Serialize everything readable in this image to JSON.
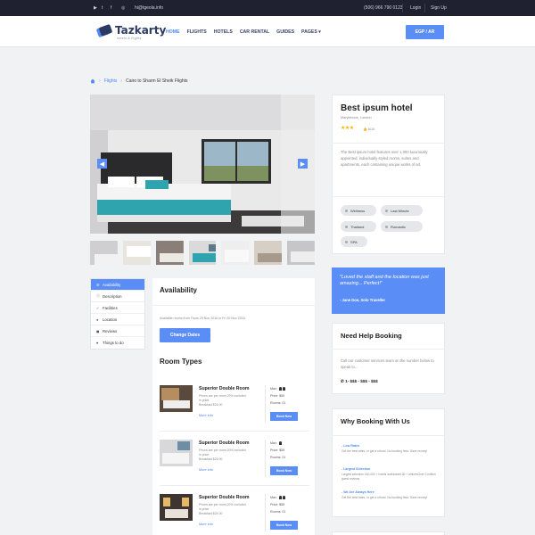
{
  "topbar": {
    "social": [
      "▶",
      "t",
      "f",
      "◎"
    ],
    "email": "hi@tgeola.info",
    "phone": "(506) 966 790 0123",
    "login": "Login",
    "signup": "Sign Up"
  },
  "header": {
    "logo": "Tazkarty",
    "tagline": "hotels & flights",
    "nav": [
      "HOME",
      "FLIGHTS",
      "HOTELS",
      "CAR RENTAL",
      "GUIDES",
      "PAGES ▾"
    ],
    "cta": "EGP / AR"
  },
  "breadcrumb": {
    "items": [
      "Flights",
      "Cairo to Sharm El Sheik Flights"
    ]
  },
  "tabs": [
    "Availability",
    "Description",
    "Facilities",
    "Location",
    "Reviews",
    "Things to do"
  ],
  "availability": {
    "title": "Availability",
    "text": "Available rooms from Thurs 29 Nov 2016 to Fri 30 Nov 2016.",
    "button": "Change Dates"
  },
  "rooms": {
    "title": "Room Types",
    "items": [
      {
        "name": "Superior Double Room",
        "desc1": "Prices are per room 20% included",
        "desc2": "in price",
        "desc3": "Breakfast $24.00",
        "more": "More info",
        "max": "Max:",
        "price": "Price: $50",
        "rooms": "Rooms: 01",
        "book": "Book Now"
      },
      {
        "name": "Superior Double Room",
        "desc1": "Prices are per room 20% included",
        "desc2": "in price",
        "desc3": "Breakfast $24.00",
        "more": "More info",
        "max": "Max:",
        "price": "Price: $55",
        "rooms": "Rooms: 01",
        "book": "Book Now"
      },
      {
        "name": "Superior Double Room",
        "desc1": "Prices are per room 20% included",
        "desc2": "in price",
        "desc3": "Breakfast $24.00",
        "more": "More info",
        "max": "Max:",
        "price": "Price: $55",
        "rooms": "Rooms: 01",
        "book": "Book Now"
      }
    ]
  },
  "hotel": {
    "name": "Best ipsum hotel",
    "location": "Marylebone, London",
    "stars": "★★★",
    "rating": "8/10",
    "description": "The Best ipsum hotel features over 1,000 luxuriously appointed, individually styled rooms, suites and apartments, each containing unique works of art.",
    "tags": [
      "Wellness",
      "Last Minute",
      "Thailand",
      "Romantic",
      "SPA"
    ]
  },
  "testimonial": {
    "quote": "\"Loved the staff and the location was just amazing... Perfect!\"",
    "author": "- Jane Doe, Solo Traveller"
  },
  "help": {
    "title": "Need Help Booking",
    "text": "Call our customer services team on the number below to speak to...",
    "phone": "1- $$$ - $$$ - $$$"
  },
  "why": {
    "title": "Why Booking With Us",
    "items": [
      {
        "title": "- Low Rates",
        "text": "Get the best rates, or get a refund. No booking fees. Save money!"
      },
      {
        "title": "- Largest Selection",
        "text": "Largest selection 140,000 + hotels worldwide130 + airlinesOver 3 million guest reviews"
      },
      {
        "title": "- We Are Always Here",
        "text": "Get the best rates, or get a refund. No booking fees. Save money!"
      }
    ]
  },
  "colors": {
    "accent": "#5b8df7",
    "dark": "#1f2030",
    "star": "#f5b300"
  }
}
